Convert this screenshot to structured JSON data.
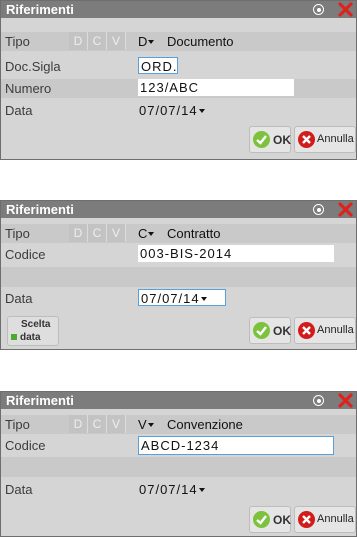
{
  "dialogs": [
    {
      "title": "Riferimenti",
      "tipo_label": "Tipo",
      "segments": [
        "D",
        "C",
        "V"
      ],
      "type_code": "D",
      "type_name": "Documento",
      "field1_label": "Doc.Sigla",
      "field1_value": "ORD.",
      "field2_label": "Numero",
      "field2_value": "123/ABC",
      "data_label": "Data",
      "data_value": "07/07/14",
      "ok_label": "OK",
      "annulla_label": "Annulla"
    },
    {
      "title": "Riferimenti",
      "tipo_label": "Tipo",
      "segments": [
        "D",
        "C",
        "V"
      ],
      "type_code": "C",
      "type_name": "Contratto",
      "codice_label": "Codice",
      "codice_value": "003-BIS-2014",
      "data_label": "Data",
      "data_value": "07/07/14",
      "scelta_label_1": "Scelta",
      "scelta_label_2": "data",
      "ok_label": "OK",
      "annulla_label": "Annulla"
    },
    {
      "title": "Riferimenti",
      "tipo_label": "Tipo",
      "segments": [
        "D",
        "C",
        "V"
      ],
      "type_code": "V",
      "type_name": "Convenzione",
      "codice_label": "Codice",
      "codice_value": "ABCD-1234",
      "data_label": "Data",
      "data_value": "07/07/14",
      "ok_label": "OK",
      "annulla_label": "Annulla"
    }
  ],
  "colors": {
    "titlebar": "#7c7c7c",
    "panel": "#d5d5d5",
    "focus_border": "#5aa0d8",
    "ok_green": "#7dc23c",
    "cancel_red": "#d21c1c"
  },
  "icons": [
    "radio-icon",
    "close-icon",
    "check-icon",
    "cancel-icon",
    "calendar-icon"
  ]
}
